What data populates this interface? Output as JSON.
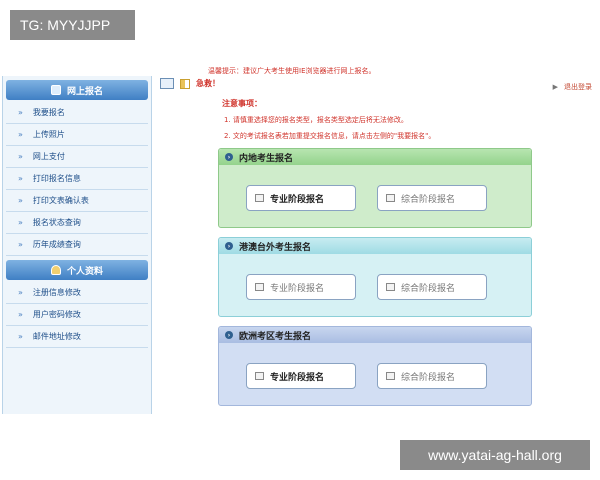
{
  "watermarks": {
    "top_left": "TG: MYYJJPP",
    "bottom_right": "www.yatai-ag-hall.org"
  },
  "sidebar": {
    "section1_title": "网上报名",
    "section1_items": [
      {
        "label": "我要报名"
      },
      {
        "label": "上传照片"
      },
      {
        "label": "网上支付"
      },
      {
        "label": "打印报名信息"
      },
      {
        "label": "打印文表确认表"
      },
      {
        "label": "报名状态查询"
      },
      {
        "label": "历年成绩查询"
      }
    ],
    "section2_title": "个人资料",
    "section2_items": [
      {
        "label": "注册信息修改"
      },
      {
        "label": "用户密码修改"
      },
      {
        "label": "邮件地址修改"
      }
    ]
  },
  "topbar": {
    "notice": "温馨提示：建议广大考生使用IE浏览器进行网上报名。",
    "alert": "急救！",
    "exit": "退出登录"
  },
  "notes": {
    "title": "注意事项：",
    "items": [
      "1. 请慎重选择您的报名类型，报名类型选定后将无法修改。",
      "2. 文的考试报名表若加重提交报名信息，请点击左侧的\"我要报名\"。"
    ]
  },
  "panels": [
    {
      "title": "内地考生报名",
      "btn_left": "专业阶段报名",
      "btn_right": "综合阶段报名"
    },
    {
      "title": "港澳台外考生报名",
      "btn_left": "专业阶段报名",
      "btn_right": "综合阶段报名"
    },
    {
      "title": "欧洲考区考生报名",
      "btn_left": "专业阶段报名",
      "btn_right": "综合阶段报名"
    }
  ]
}
